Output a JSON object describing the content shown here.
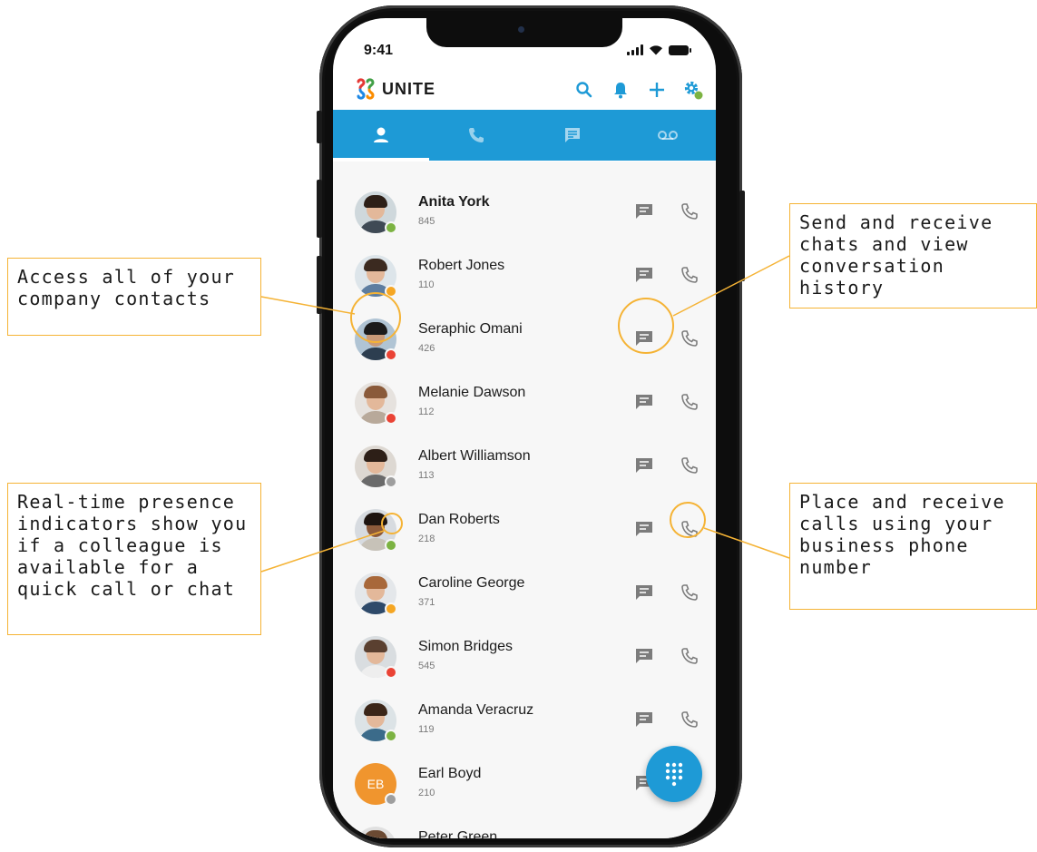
{
  "status_bar": {
    "time": "9:41"
  },
  "app": {
    "name": "UNITE"
  },
  "header_actions": [
    "search-icon",
    "bell-icon",
    "add-icon",
    "settings-icon"
  ],
  "tabs": [
    {
      "name": "contacts",
      "icon": "person-icon",
      "active": true
    },
    {
      "name": "calls",
      "icon": "phone-icon",
      "active": false
    },
    {
      "name": "chats",
      "icon": "chat-icon",
      "active": false
    },
    {
      "name": "voicemail",
      "icon": "voicemail-icon",
      "active": false
    }
  ],
  "contacts": [
    {
      "name": "Anita York",
      "ext": "845",
      "presence": "available"
    },
    {
      "name": "Robert Jones",
      "ext": "110",
      "presence": "away"
    },
    {
      "name": "Seraphic Omani",
      "ext": "426",
      "presence": "on-call"
    },
    {
      "name": "Melanie Dawson",
      "ext": "112",
      "presence": "busy"
    },
    {
      "name": "Albert Williamson",
      "ext": "113",
      "presence": "offline"
    },
    {
      "name": "Dan Roberts",
      "ext": "218",
      "presence": "available"
    },
    {
      "name": "Caroline George",
      "ext": "371",
      "presence": "away"
    },
    {
      "name": "Simon Bridges",
      "ext": "545",
      "presence": "on-call"
    },
    {
      "name": "Amanda Veracruz",
      "ext": "119",
      "presence": "available"
    },
    {
      "name": "Earl Boyd",
      "ext": "210",
      "presence": "offline",
      "initials": "EB"
    },
    {
      "name": "Peter Green",
      "ext": "",
      "presence": ""
    }
  ],
  "callouts": {
    "contacts": "Access all of your company contacts",
    "presence": "Real-time presence indicators show you if a colleague is available for a quick call or chat",
    "chat": "Send and receive chats and view conversation history",
    "call": "Place and receive calls using your business phone number"
  },
  "colors": {
    "accent": "#1e9ad6",
    "callout_border": "#f5b335",
    "available": "#7cb342",
    "away": "#f5a623",
    "busy": "#ea4335",
    "offline": "#9e9e9e"
  }
}
